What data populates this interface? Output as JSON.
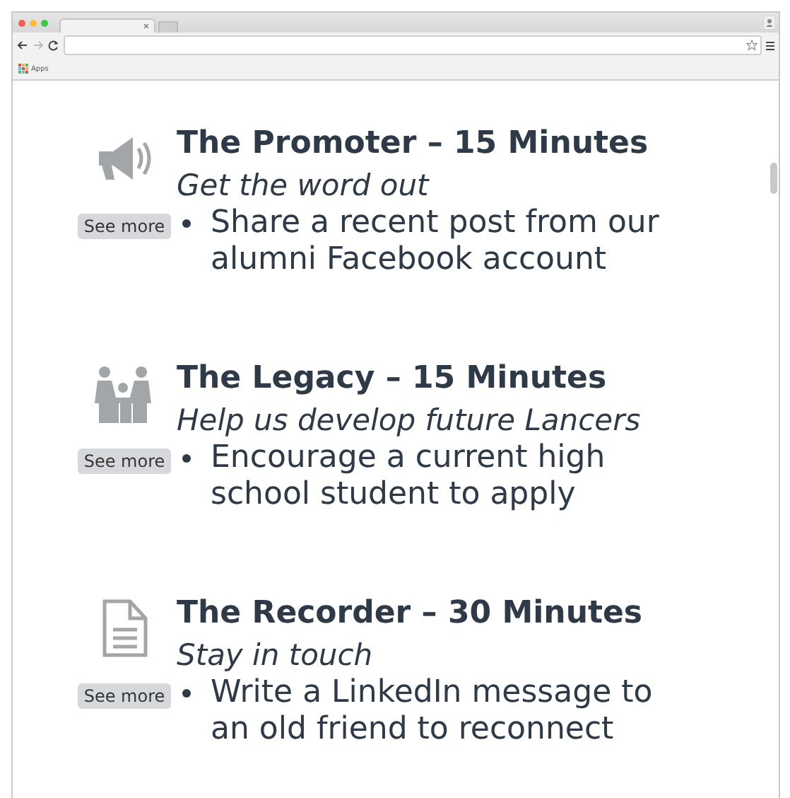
{
  "browser": {
    "bookmarks": [
      "Apps"
    ]
  },
  "activities": [
    {
      "kind": "megaphone",
      "title": "The Promoter – 15 Minutes",
      "subtitle": "Get the word out",
      "button": "See more",
      "bullets": [
        "Share a recent post from our\nalumni Facebook account"
      ]
    },
    {
      "kind": "family",
      "title": "The Legacy – 15 Minutes",
      "subtitle": "Help us develop future Lancers",
      "button": "See more",
      "bullets": [
        "Encourage a current high\nschool student to apply"
      ]
    },
    {
      "kind": "document",
      "title": "The Recorder – 30 Minutes",
      "subtitle": "Stay in touch",
      "button": "See more",
      "bullets": [
        "Write a LinkedIn message to\nan old friend to reconnect"
      ]
    }
  ]
}
